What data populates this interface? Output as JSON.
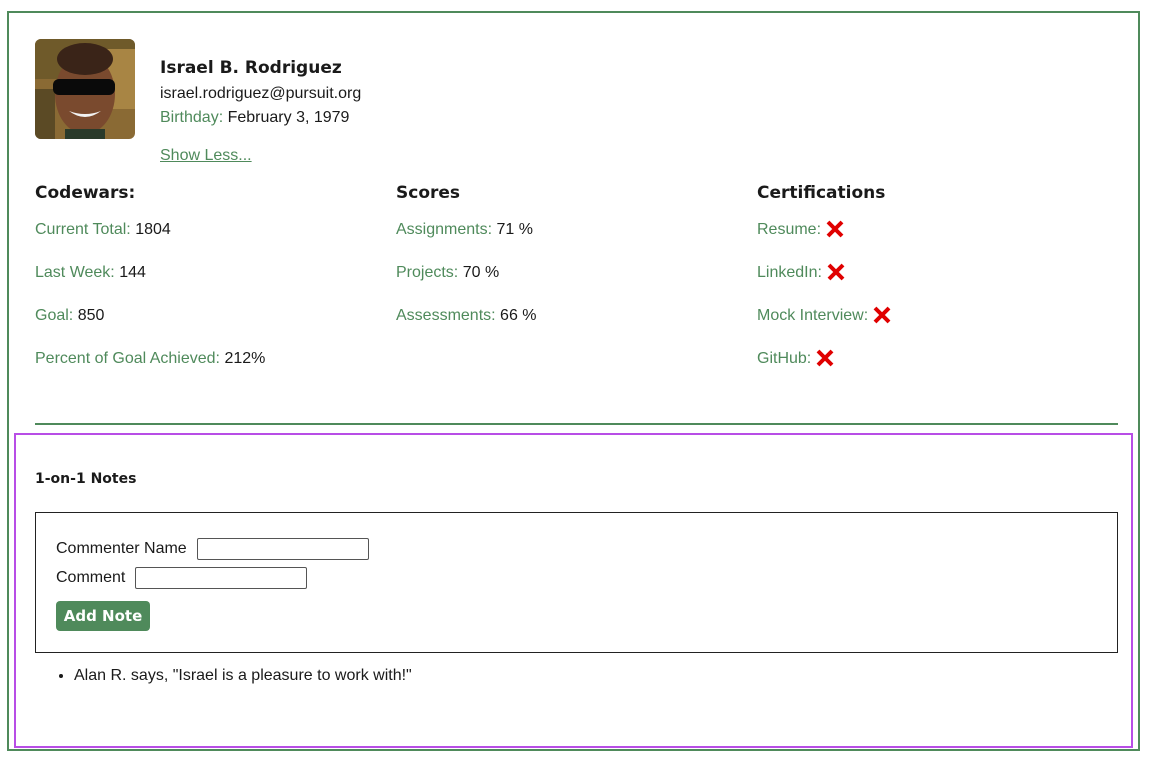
{
  "profile": {
    "name": "Israel B. Rodriguez",
    "email": "israel.rodriguez@pursuit.org",
    "birthday_label": "Birthday:",
    "birthday_value": "February 3, 1979",
    "toggle_label": "Show Less..."
  },
  "codewars": {
    "title": "Codewars:",
    "rows": [
      {
        "label": "Current Total:",
        "value": "1804"
      },
      {
        "label": "Last Week:",
        "value": "144"
      },
      {
        "label": "Goal:",
        "value": "850"
      },
      {
        "label": "Percent of Goal Achieved:",
        "value": "212%"
      }
    ]
  },
  "scores": {
    "title": "Scores",
    "rows": [
      {
        "label": "Assignments:",
        "value": "71 %"
      },
      {
        "label": "Projects:",
        "value": "70 %"
      },
      {
        "label": "Assessments:",
        "value": "66 %"
      }
    ]
  },
  "certifications": {
    "title": "Certifications",
    "rows": [
      {
        "label": "Resume:",
        "status_icon": "red-x-icon"
      },
      {
        "label": "LinkedIn:",
        "status_icon": "red-x-icon"
      },
      {
        "label": "Mock Interview:",
        "status_icon": "red-x-icon"
      },
      {
        "label": "GitHub:",
        "status_icon": "red-x-icon"
      }
    ]
  },
  "notes": {
    "title": "1-on-1 Notes",
    "commenter_label": "Commenter Name",
    "commenter_value": "",
    "comment_label": "Comment",
    "comment_value": "",
    "add_button_label": "Add Note",
    "items": [
      "Alan R. says, \"Israel is a pleasure to work with!\""
    ]
  },
  "colors": {
    "accent": "#4f8a5b",
    "notes_border": "#b84ee6",
    "fail_icon": "#e00000"
  }
}
